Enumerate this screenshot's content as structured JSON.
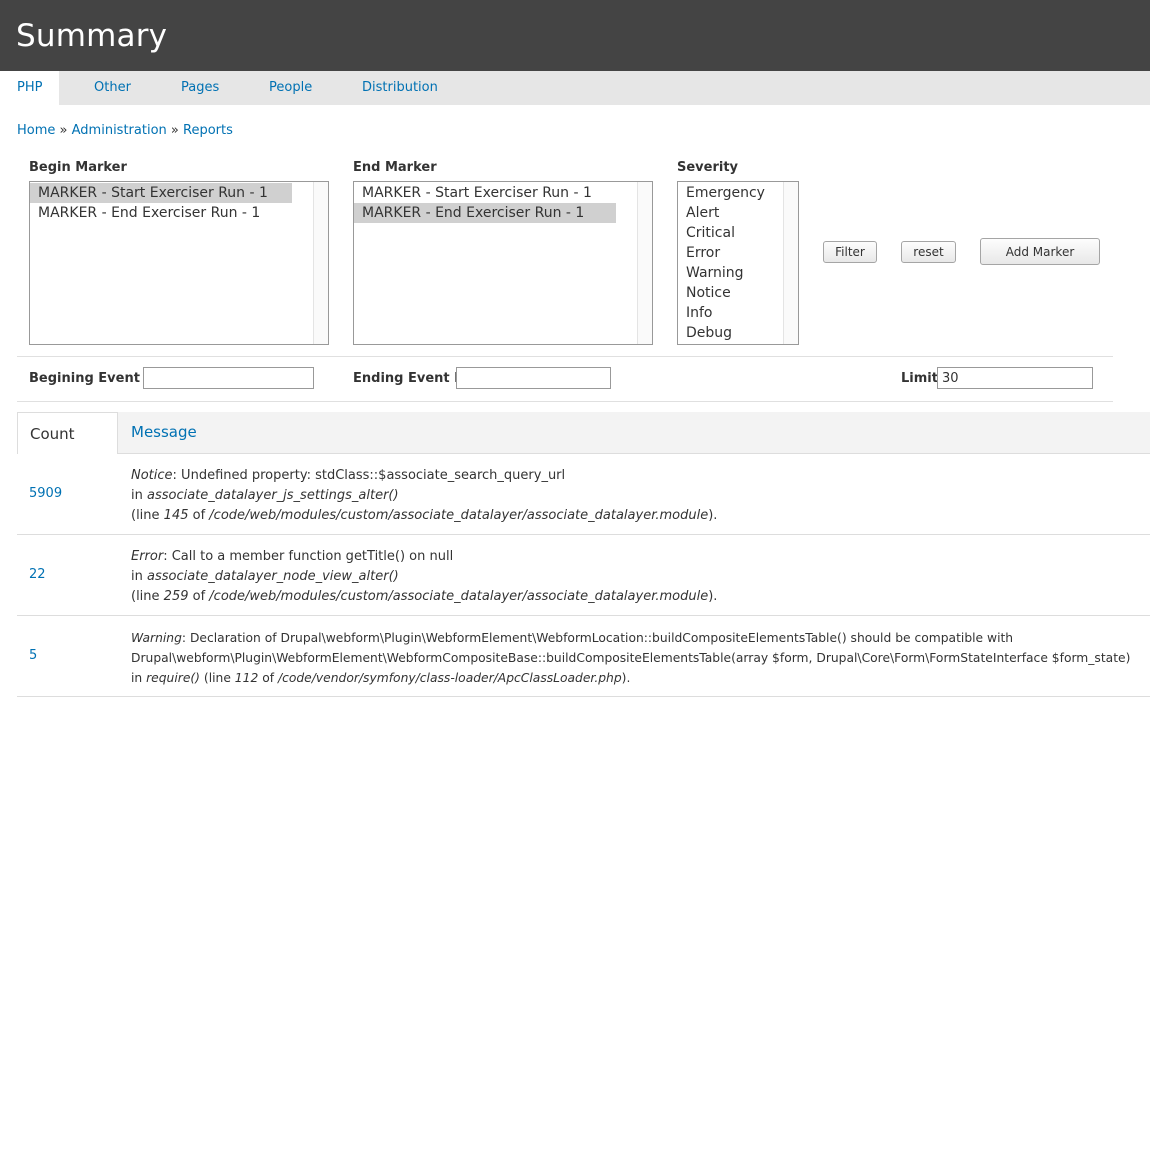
{
  "header": {
    "title": "Summary"
  },
  "tabs": [
    {
      "label": "PHP"
    },
    {
      "label": "Other"
    },
    {
      "label": "Pages"
    },
    {
      "label": "People"
    },
    {
      "label": "Distribution"
    }
  ],
  "breadcrumb": {
    "home": "Home",
    "sep": "»",
    "admin": "Administration",
    "reports": "Reports"
  },
  "filters": {
    "begin_marker": {
      "label": "Begin Marker",
      "options": [
        "MARKER - Start Exerciser Run - 1",
        "MARKER - End Exerciser Run - 1"
      ],
      "selected": "MARKER - Start Exerciser Run - 1"
    },
    "end_marker": {
      "label": "End Marker",
      "options": [
        "MARKER - Start Exerciser Run - 1",
        "MARKER - End Exerciser Run - 1"
      ],
      "selected": "MARKER - End Exerciser Run - 1"
    },
    "severity": {
      "label": "Severity",
      "options": [
        "Emergency",
        "Alert",
        "Critical",
        "Error",
        "Warning",
        "Notice",
        "Info",
        "Debug"
      ]
    },
    "filter_button": "Filter",
    "reset_button": "reset",
    "add_marker_button": "Add Marker",
    "begin_event_label": "Begining Event ID",
    "begin_event_value": "",
    "end_event_label": "Ending Event ID",
    "end_event_value": "",
    "limit_label": "Limit",
    "limit_value": "30"
  },
  "table": {
    "col_count": "Count",
    "col_message": "Message",
    "rows": [
      {
        "count": "5909",
        "type": "Notice",
        "text": ": Undefined property: stdClass::$associate_search_query_url",
        "in": "in ",
        "func": "associate_datalayer_js_settings_alter()",
        "line_pre": "(line ",
        "line": "145",
        "of": " of ",
        "file": "/code/web/modules/custom/associate_datalayer/associate_datalayer.module",
        "end": ")."
      },
      {
        "count": "22",
        "type": "Error",
        "text": ": Call to a member function getTitle() on null",
        "in": "in ",
        "func": "associate_datalayer_node_view_alter()",
        "line_pre": "(line ",
        "line": "259",
        "of": " of ",
        "file": "/code/web/modules/custom/associate_datalayer/associate_datalayer.module",
        "end": ")."
      },
      {
        "count": "5",
        "type": "Warning",
        "text": ": Declaration of Drupal\\webform\\Plugin\\WebformElement\\WebformLocation::buildCompositeElementsTable() should be compatible with",
        "text2": "Drupal\\webform\\Plugin\\WebformElement\\WebformCompositeBase::buildCompositeElementsTable(array $form, Drupal\\Core\\Form\\FormStateInterface $form_state)",
        "in": "in ",
        "func": "require()",
        "line_pre": " (line ",
        "line": "112",
        "of": " of ",
        "file": "/code/vendor/symfony/class-loader/ApcClassLoader.php",
        "end": ")."
      }
    ]
  }
}
